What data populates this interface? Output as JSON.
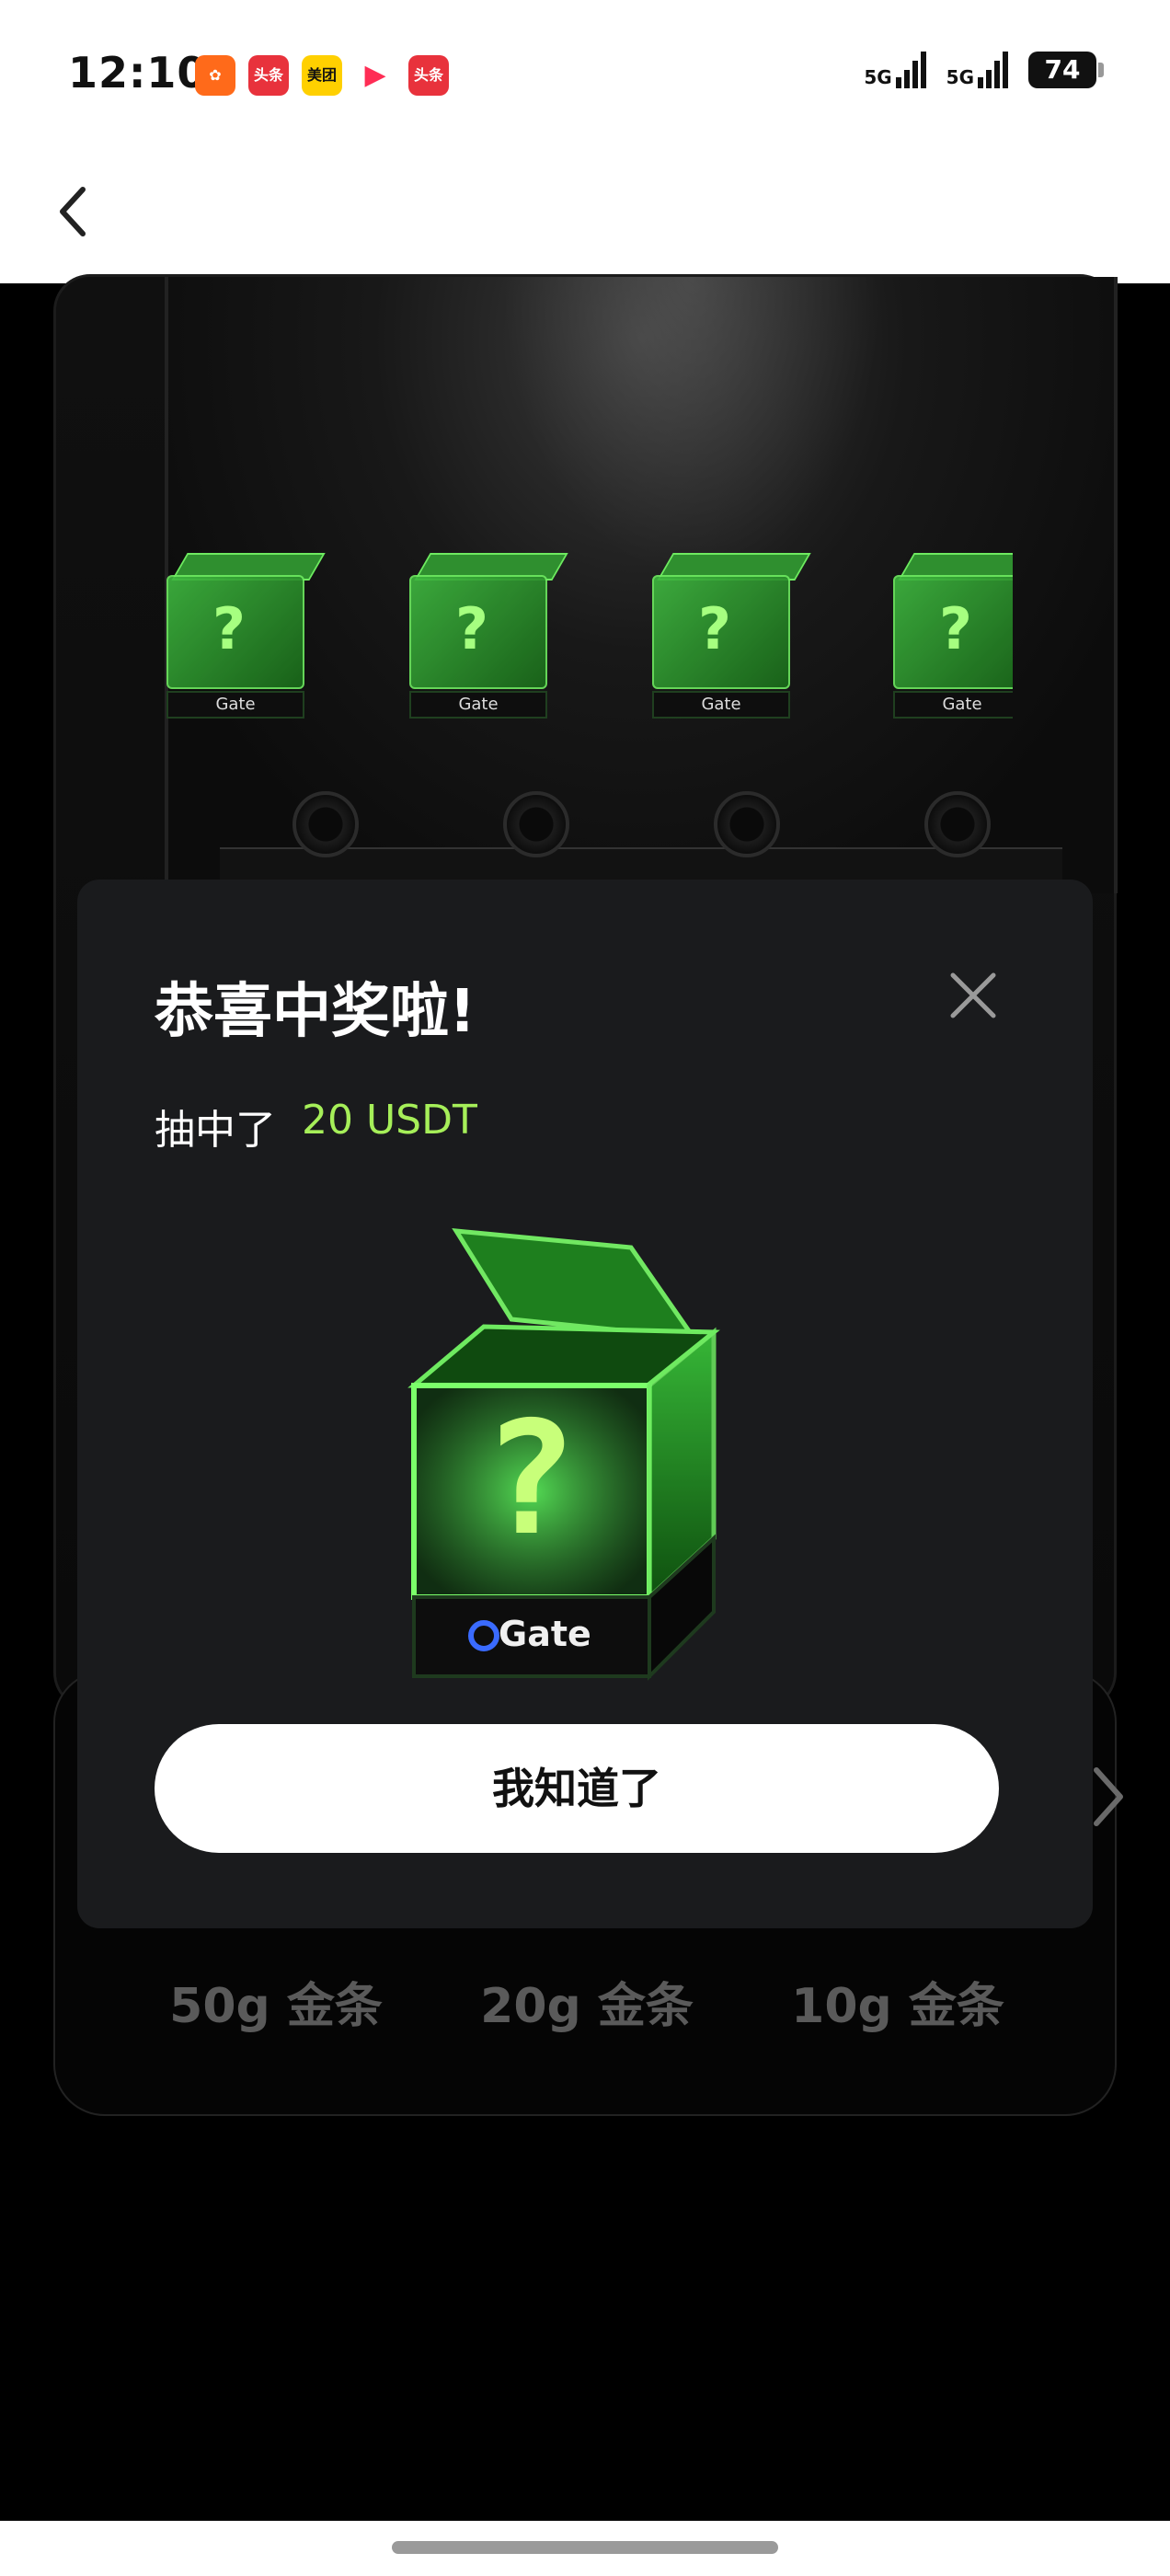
{
  "status_bar": {
    "time": "12:10",
    "notifications": [
      {
        "name": "kuaishou-icon",
        "label": "",
        "color": "#ff6a1a"
      },
      {
        "name": "toutiao-icon",
        "label": "头条",
        "color": "#e8323c"
      },
      {
        "name": "meituan-icon",
        "label": "美团",
        "color": "#ffd000"
      },
      {
        "name": "video-icon",
        "label": "",
        "color": "#ff2d55"
      },
      {
        "name": "toutiao-icon",
        "label": "头条",
        "color": "#e8323c"
      }
    ],
    "signal1": "5G",
    "signal2": "5G",
    "battery": "74"
  },
  "scene": {
    "mini_boxes": [
      {
        "brand": "Gate"
      },
      {
        "brand": "Gate"
      },
      {
        "brand": "Gate"
      },
      {
        "brand": "Gate"
      }
    ]
  },
  "modal": {
    "title": "恭喜中奖啦!",
    "win_prefix": "抽中了",
    "win_amount": "20 USDT",
    "box_brand": "Gate",
    "ok_label": "我知道了",
    "accent": "#a6ef59"
  },
  "prizes": [
    {
      "label": "50g 金条"
    },
    {
      "label": "20g 金条"
    },
    {
      "label": "10g 金条"
    }
  ]
}
